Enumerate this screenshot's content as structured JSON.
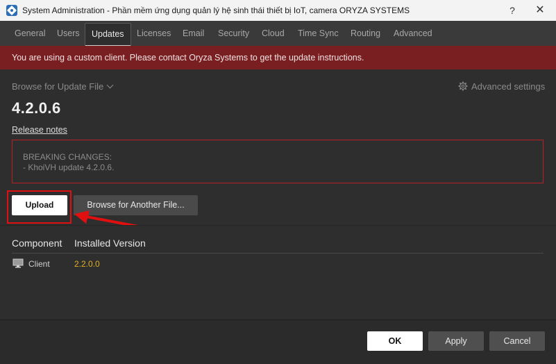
{
  "window": {
    "title": "System Administration - Phần mềm ứng dụng quản lý hệ sinh thái thiết bị IoT, camera ORYZA SYSTEMS",
    "help_label": "?",
    "close_label": "✕"
  },
  "tabs": [
    {
      "label": "General"
    },
    {
      "label": "Users"
    },
    {
      "label": "Updates",
      "active": true
    },
    {
      "label": "Licenses"
    },
    {
      "label": "Email"
    },
    {
      "label": "Security"
    },
    {
      "label": "Cloud"
    },
    {
      "label": "Time Sync"
    },
    {
      "label": "Routing"
    },
    {
      "label": "Advanced"
    }
  ],
  "banner": {
    "text": "You are using a custom client. Please contact Oryza Systems to get the update instructions.",
    "color": "#7a1f21"
  },
  "update": {
    "browse_label": "Browse for Update File",
    "advanced_settings_label": "Advanced settings",
    "version": "4.2.0.6",
    "release_notes_label": "Release notes",
    "notes_line1": "BREAKING CHANGES:",
    "notes_line2": "- KhoiVH update 4.2.0.6.",
    "upload_label": "Upload",
    "browse_another_label": "Browse for Another File..."
  },
  "components": {
    "headers": [
      "Component",
      "Installed Version"
    ],
    "rows": [
      {
        "name": "Client",
        "version": "2.2.0.0",
        "icon": "monitor-icon"
      }
    ]
  },
  "footer": {
    "ok_label": "OK",
    "apply_label": "Apply",
    "cancel_label": "Cancel"
  },
  "colors": {
    "accent_red": "#e01010",
    "version_yellow": "#e3b020"
  }
}
